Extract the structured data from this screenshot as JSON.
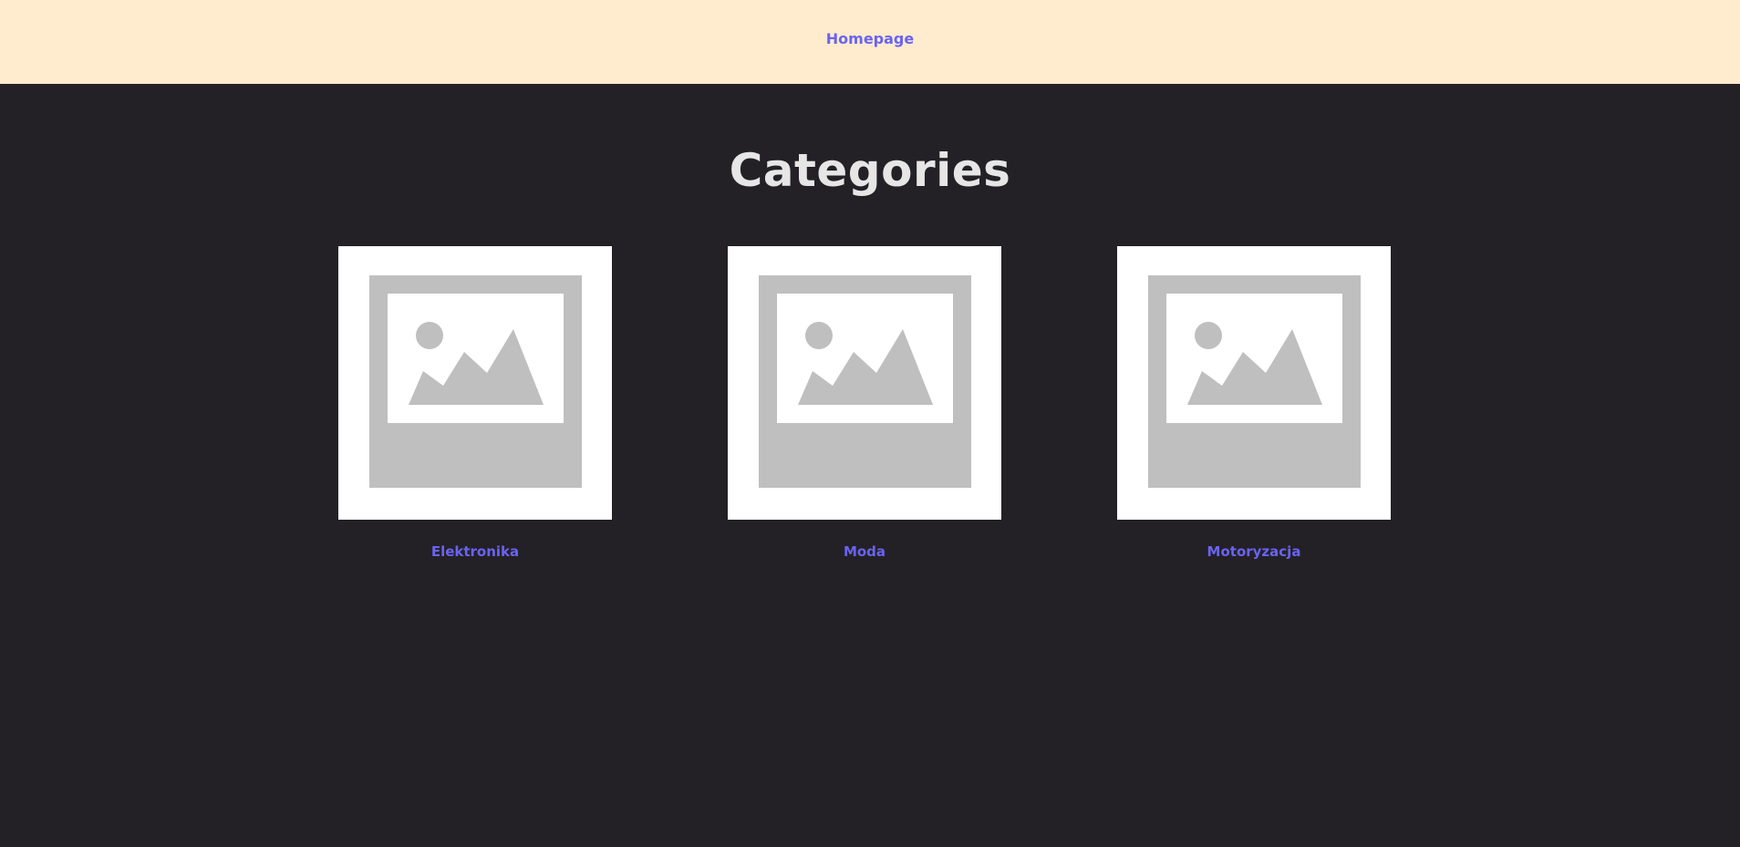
{
  "nav": {
    "home_label": "Homepage"
  },
  "page": {
    "title": "Categories"
  },
  "categories": [
    {
      "label": "Elektronika",
      "icon": "image-placeholder-icon"
    },
    {
      "label": "Moda",
      "icon": "image-placeholder-icon"
    },
    {
      "label": "Motoryzacja",
      "icon": "image-placeholder-icon"
    }
  ],
  "colors": {
    "topbar_bg": "#ffecce",
    "page_bg": "#232126",
    "link": "#6a63f2",
    "title": "#e6e6e6",
    "placeholder_gray": "#bfbfbf"
  }
}
